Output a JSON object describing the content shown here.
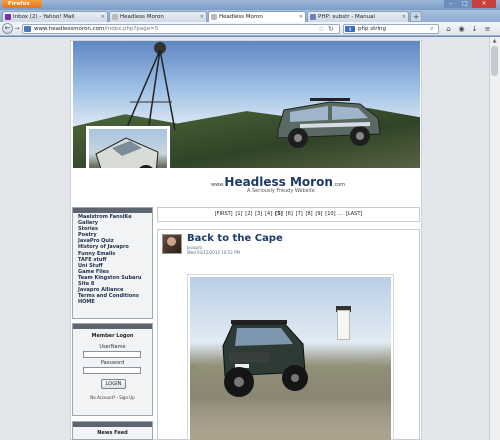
{
  "browser": {
    "app_button": "Firefox",
    "tabs": [
      {
        "label": "Inbox (2) - Yahoo! Mail"
      },
      {
        "label": "Headless Moron"
      },
      {
        "label": "Headless Moron"
      },
      {
        "label": "PHP: substr - Manual"
      }
    ],
    "url_domain": "www.headlessmoron.com",
    "url_path": "/index.php?page=5",
    "search_value": "php string",
    "search_engine_icon": "google-icon"
  },
  "site": {
    "logo_prefix": "www.",
    "logo_name": "Headless Moron",
    "logo_suffix": ".com",
    "tagline": "A Seriously Freudy Website",
    "menu": [
      "Maelstrom FansiKe",
      "Gallery",
      "Stories",
      "Poetry",
      "JavaPro Quiz",
      "History of Javapro",
      "Funny Emails",
      "TAFE stuff",
      "Uni Stuff",
      "Game Files",
      "Team Kingston Subaru",
      "Site 8",
      "Javapro Alliance",
      "Terms and Conditions",
      "HOME"
    ],
    "login": {
      "title": "Member Logon",
      "username_label": "UserName",
      "password_label": "Password",
      "button": "LOGIN",
      "signup_text": "No Account? - Sign Up"
    },
    "news_title": "News Feed",
    "pager": {
      "first": "[FIRST]",
      "pages": [
        "[1]",
        "[2]",
        "[3]",
        "[4]",
        "[5]",
        "[6]",
        "[7]",
        "[8]",
        "[9]",
        "[10]"
      ],
      "current_index": 4,
      "ellipsis": "...",
      "last": "[LAST]"
    },
    "post": {
      "title": "Back to the Cape",
      "author": "Javapro",
      "date": "Wed 03/12/2012 10:52 PM"
    }
  },
  "colors": {
    "title_blue": "#1d3b66",
    "menu_text": "#1c2f4d",
    "firefox_orange": "#e0741a"
  }
}
